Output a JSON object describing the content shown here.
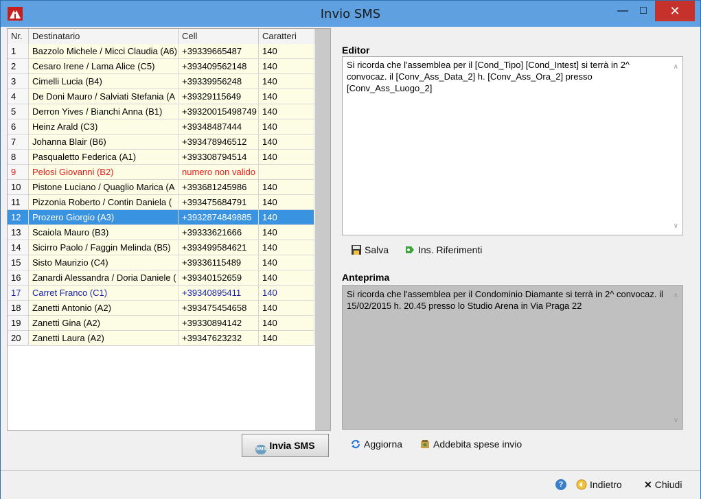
{
  "window": {
    "title": "Invio SMS"
  },
  "grid": {
    "columns": [
      "Nr.",
      "Destinatario",
      "Cell",
      "Caratteri"
    ],
    "rows": [
      {
        "nr": "1",
        "dest": "Bazzolo Michele / Micci Claudia (A6)",
        "cell": "+39339665487",
        "chars": "140",
        "state": "normal"
      },
      {
        "nr": "2",
        "dest": "Cesaro Irene / Lama Alice (C5)",
        "cell": "+393409562148",
        "chars": "140",
        "state": "normal"
      },
      {
        "nr": "3",
        "dest": "Cimelli Lucia (B4)",
        "cell": "+39339956248",
        "chars": "140",
        "state": "normal"
      },
      {
        "nr": "4",
        "dest": "De Doni Mauro / Salviati Stefania (A",
        "cell": "+39329115649",
        "chars": "140",
        "state": "normal"
      },
      {
        "nr": "5",
        "dest": "Derron Yives / Bianchi Anna (B1)",
        "cell": "+39320015498749",
        "chars": "140",
        "state": "normal"
      },
      {
        "nr": "6",
        "dest": "Heinz Arald (C3)",
        "cell": "+39348487444",
        "chars": "140",
        "state": "normal"
      },
      {
        "nr": "7",
        "dest": "Johanna Blair (B6)",
        "cell": "+393478946512",
        "chars": "140",
        "state": "normal"
      },
      {
        "nr": "8",
        "dest": "Pasqualetto Federica (A1)",
        "cell": "+393308794514",
        "chars": "140",
        "state": "normal"
      },
      {
        "nr": "9",
        "dest": "Pelosi Giovanni (B2)",
        "cell": "numero non valido",
        "chars": "",
        "state": "invalid"
      },
      {
        "nr": "10",
        "dest": "Pistone Luciano / Quaglio Marica (A",
        "cell": "+393681245986",
        "chars": "140",
        "state": "normal"
      },
      {
        "nr": "11",
        "dest": "Pizzonia Roberto / Contin Daniela (",
        "cell": "+393475684791",
        "chars": "140",
        "state": "normal"
      },
      {
        "nr": "12",
        "dest": "Prozero Giorgio (A3)",
        "cell": "+3932874849885",
        "chars": "140",
        "state": "selected"
      },
      {
        "nr": "13",
        "dest": "Scaiola Mauro (B3)",
        "cell": "+39333621666",
        "chars": "140",
        "state": "normal"
      },
      {
        "nr": "14",
        "dest": "Sicirro Paolo / Faggin Melinda (B5)",
        "cell": "+393499584621",
        "chars": "140",
        "state": "normal"
      },
      {
        "nr": "15",
        "dest": "Sisto Maurizio (C4)",
        "cell": "+39336115489",
        "chars": "140",
        "state": "normal"
      },
      {
        "nr": "16",
        "dest": "Zanardi Alessandra / Doria Daniele (",
        "cell": "+39340152659",
        "chars": "140",
        "state": "normal"
      },
      {
        "nr": "17",
        "dest": "Carret Franco (C1)",
        "cell": "+39340895411",
        "chars": "140",
        "state": "highlight"
      },
      {
        "nr": "18",
        "dest": "Zanetti Antonio (A2)",
        "cell": "+393475454658",
        "chars": "140",
        "state": "normal"
      },
      {
        "nr": "19",
        "dest": "Zanetti Gina (A2)",
        "cell": "+39330894142",
        "chars": "140",
        "state": "normal"
      },
      {
        "nr": "20",
        "dest": "Zanetti Laura (A2)",
        "cell": "+39347623232",
        "chars": "140",
        "state": "normal"
      }
    ]
  },
  "editor": {
    "label": "Editor",
    "text": "Si ricorda che l'assemblea per il [Cond_Tipo] [Cond_Intest] si terrà in 2^ convocaz. il [Conv_Ass_Data_2] h. [Conv_Ass_Ora_2] presso [Conv_Ass_Luogo_2]"
  },
  "preview": {
    "label": "Anteprima",
    "text": "Si ricorda che l'assemblea per il Condominio Diamante si terrà in 2^ convocaz. il 15/02/2015 h. 20.45 presso lo Studio Arena in Via Praga 22"
  },
  "buttons": {
    "salva": "Salva",
    "ins_riferimenti": "Ins. Riferimenti",
    "invia_sms": "Invia SMS",
    "sms_icon_text": "SMS",
    "aggiorna": "Aggiorna",
    "addebita": "Addebita spese invio",
    "indietro": "Indietro",
    "chiudi": "Chiudi",
    "help": "?"
  },
  "colors": {
    "selected": "#3a93e0",
    "invalid": "#e01b1b",
    "highlight": "#1a24a8",
    "cell_bg": "#fdfde6"
  },
  "icons": {
    "salva": "save-icon",
    "ins_riferimenti": "insert-reference-icon",
    "aggiorna": "refresh-icon",
    "addebita": "charge-icon",
    "help": "help-icon",
    "indietro": "back-icon",
    "chiudi": "close-icon"
  }
}
